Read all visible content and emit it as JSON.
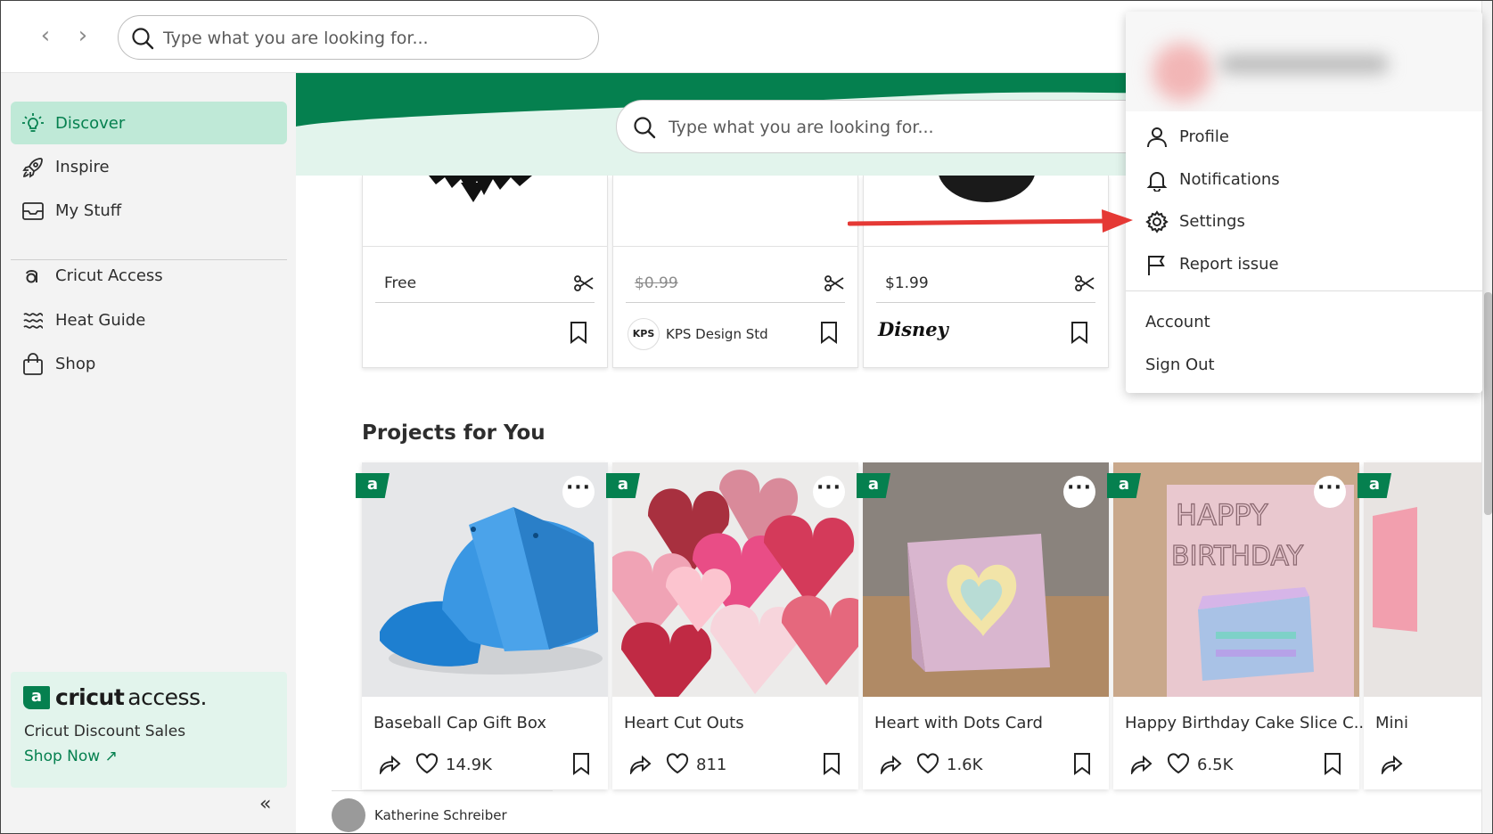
{
  "topbar": {
    "search_placeholder": "Type what you are looking for..."
  },
  "sidebar": {
    "items": [
      {
        "label": "Discover",
        "icon": "lightbulb-icon",
        "active": true
      },
      {
        "label": "Inspire",
        "icon": "rocket-icon"
      },
      {
        "label": "My Stuff",
        "icon": "inbox-icon"
      },
      {
        "label": "Cricut Access",
        "icon": "cricut-access-icon"
      },
      {
        "label": "Heat Guide",
        "icon": "heat-waves-icon"
      },
      {
        "label": "Shop",
        "icon": "shopping-bag-icon"
      }
    ],
    "access_card": {
      "badge": "a",
      "brand_bold": "cricut",
      "brand_light": "access.",
      "text": "Cricut Discount Sales",
      "link": "Shop Now ↗"
    },
    "collapse": "«"
  },
  "main": {
    "hero_search_placeholder": "Type what you are looking for...",
    "designs": [
      {
        "price": "Free",
        "strike": false
      },
      {
        "price": "$0.99",
        "strike": true,
        "creator": "KPS Design Std",
        "creator_badge": "KPS"
      },
      {
        "price": "$1.99",
        "strike": false,
        "creator_logo": "Disney"
      }
    ],
    "section_title": "Projects for You",
    "projects": [
      {
        "title": "Baseball Cap Gift Box",
        "likes": "14.9K"
      },
      {
        "title": "Heart Cut Outs",
        "likes": "811"
      },
      {
        "title": "Heart with Dots Card",
        "likes": "1.6K"
      },
      {
        "title": "Happy Birthday Cake Slice C...",
        "likes": "6.5K"
      },
      {
        "title": "Mini",
        "likes": ""
      }
    ],
    "author": "Katherine Schreiber"
  },
  "dropdown": {
    "items": [
      {
        "label": "Profile",
        "icon": "person-icon"
      },
      {
        "label": "Notifications",
        "icon": "bell-icon"
      },
      {
        "label": "Settings",
        "icon": "gear-icon"
      },
      {
        "label": "Report issue",
        "icon": "flag-icon"
      }
    ],
    "account": "Account",
    "sign_out": "Sign Out"
  },
  "colors": {
    "brand_green": "#05804f",
    "active_bg": "#bfe9d7",
    "arrow_red": "#e53935"
  }
}
